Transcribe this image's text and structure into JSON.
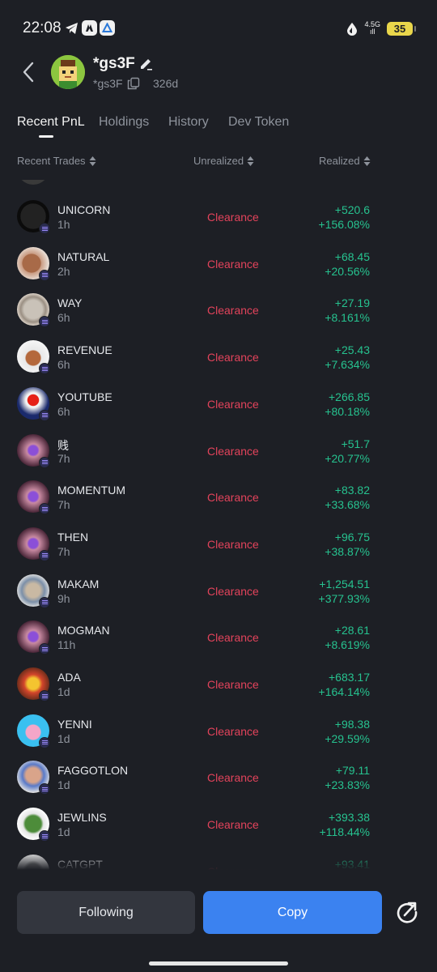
{
  "status_bar": {
    "time": "22:08",
    "network_top": "4.5G",
    "network_bottom": "ıll",
    "battery": "35"
  },
  "profile": {
    "name": "*gs3F",
    "address": "*gs3F",
    "age": "326d"
  },
  "tabs": [
    {
      "label": "Recent PnL"
    },
    {
      "label": "Holdings"
    },
    {
      "label": "History"
    },
    {
      "label": "Dev Token"
    }
  ],
  "columns": {
    "recent_trades": "Recent Trades",
    "unrealized": "Unrealized",
    "realized": "Realized"
  },
  "trades": [
    {
      "name": "UNICORN",
      "time": "1h",
      "unrealized": "Clearance",
      "pnl": "+520.6",
      "pct": "+156.08%"
    },
    {
      "name": "NATURAL",
      "time": "2h",
      "unrealized": "Clearance",
      "pnl": "+68.45",
      "pct": "+20.56%"
    },
    {
      "name": "WAY",
      "time": "6h",
      "unrealized": "Clearance",
      "pnl": "+27.19",
      "pct": "+8.161%"
    },
    {
      "name": "REVENUE",
      "time": "6h",
      "unrealized": "Clearance",
      "pnl": "+25.43",
      "pct": "+7.634%"
    },
    {
      "name": "YOUTUBE",
      "time": "6h",
      "unrealized": "Clearance",
      "pnl": "+266.85",
      "pct": "+80.18%"
    },
    {
      "name": "贱",
      "time": "7h",
      "unrealized": "Clearance",
      "pnl": "+51.7",
      "pct": "+20.77%"
    },
    {
      "name": "MOMENTUM",
      "time": "7h",
      "unrealized": "Clearance",
      "pnl": "+83.82",
      "pct": "+33.68%"
    },
    {
      "name": "THEN",
      "time": "7h",
      "unrealized": "Clearance",
      "pnl": "+96.75",
      "pct": "+38.87%"
    },
    {
      "name": "MAKAM",
      "time": "9h",
      "unrealized": "Clearance",
      "pnl": "+1,254.51",
      "pct": "+377.93%"
    },
    {
      "name": "MOGMAN",
      "time": "11h",
      "unrealized": "Clearance",
      "pnl": "+28.61",
      "pct": "+8.619%"
    },
    {
      "name": "ADA",
      "time": "1d",
      "unrealized": "Clearance",
      "pnl": "+683.17",
      "pct": "+164.14%"
    },
    {
      "name": "YENNI",
      "time": "1d",
      "unrealized": "Clearance",
      "pnl": "+98.38",
      "pct": "+29.59%"
    },
    {
      "name": "FAGGOTLON",
      "time": "1d",
      "unrealized": "Clearance",
      "pnl": "+79.11",
      "pct": "+23.83%"
    },
    {
      "name": "JEWLINS",
      "time": "1d",
      "unrealized": "Clearance",
      "pnl": "+393.38",
      "pct": "+118.44%"
    },
    {
      "name": "CATGPT",
      "time": "",
      "unrealized": "Clearance",
      "pnl": "+93.41",
      "pct": ""
    }
  ],
  "avatar_styles": [
    "radial-gradient(circle at 50% 50%, #222 0 55%, #0b0b0b 56%)",
    "radial-gradient(circle at 45% 50%, #a86a48 0 38%, #c99b82 40%, #e8ddd4 70%)",
    "radial-gradient(circle at 50% 50%, #c9c2b8 0 40%, #9a8f83 55%, #d9cfc4 70%)",
    "radial-gradient(circle at 50% 55%, #b4683c 0 30%, #e8e8e8 34%, #f5f5f5 70%)",
    "radial-gradient(circle at 50% 40%, #e62117 0 22%, #f2f2f2 24% 30%, #1a2a6c 60%)",
    "radial-gradient(circle at 50% 50%, #8b4fd8 0 20%, #c98aa2 28%, #4a2638 70%)",
    "radial-gradient(circle at 50% 50%, #8b4fd8 0 20%, #c98aa2 28%, #4a2638 70%)",
    "radial-gradient(circle at 50% 50%, #8b4fd8 0 20%, #c98aa2 28%, #4a2638 70%)",
    "radial-gradient(circle at 50% 50%, #c9b9a3 0 30%, #7b8fa8 50%, #dcdcdc 72%)",
    "radial-gradient(circle at 50% 50%, #8b4fd8 0 20%, #c98aa2 28%, #4a2638 70%)",
    "radial-gradient(circle at 50% 50%, #f4c430 0 25%, #d2452b 40%, #6b2c1a 72%)",
    "radial-gradient(circle at 50% 55%, #f4a6c8 0 30%, #3ac0f0 34%)",
    "radial-gradient(circle at 50% 45%, #d9a48a 0 30%, #5a7ac8 45%, #e0e0e0 72%)",
    "radial-gradient(circle at 50% 50%, #4d8c3a 0 35%, #e6e6e6 45%, #ffffff 72%)",
    "radial-gradient(circle at 50% 50%, #888 0 30%, #e8e8e8 45%)"
  ],
  "actions": {
    "following": "Following",
    "copy": "Copy"
  },
  "colors": {
    "background": "#1d1f25",
    "positive": "#26c28f",
    "negative": "#e2435b",
    "accent": "#3b82f0"
  }
}
